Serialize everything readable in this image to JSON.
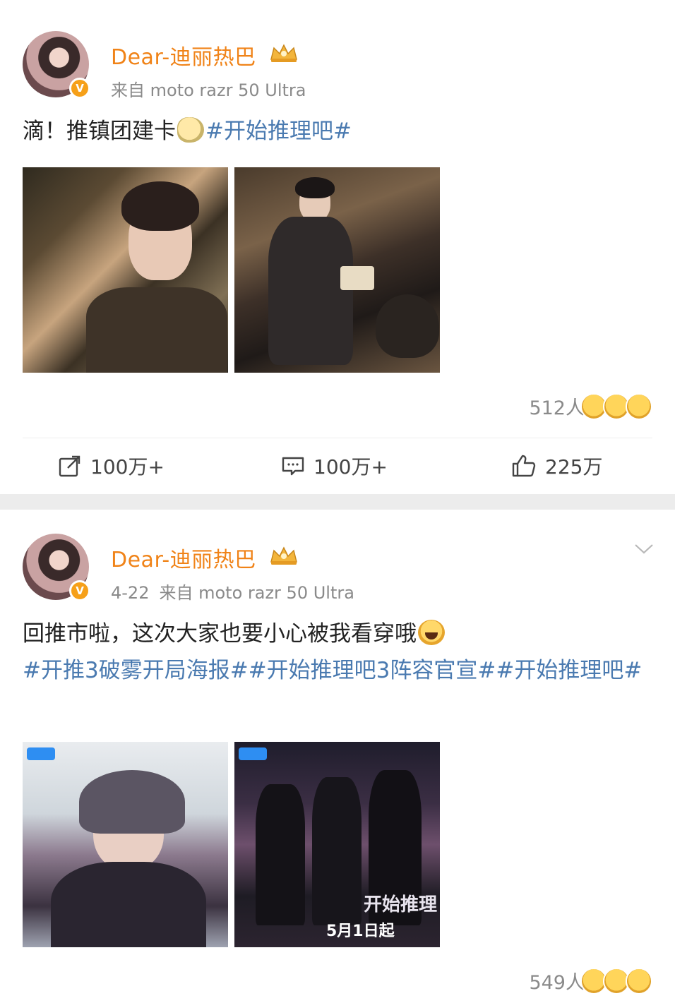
{
  "posts": [
    {
      "username": "Dear-迪丽热巴",
      "verified_badge": "V",
      "date": "",
      "source": "来自 moto razr 50 Ultra",
      "text_plain": "滴！推镇团建卡",
      "hashtags_line": "#开始推理吧#",
      "reactions_count": "512人",
      "actions": {
        "repost": "100万+",
        "comment": "100万+",
        "like": "225万"
      }
    },
    {
      "username": "Dear-迪丽热巴",
      "verified_badge": "V",
      "date": "4-22",
      "source": "来自 moto razr 50 Ultra",
      "text_plain": "回推市啦，这次大家也要小心被我看穿哦",
      "hashtags_line": "#开推3破雾开局海报##开始推理吧3阵容官宣##开始推理吧#",
      "reactions_count": "549人",
      "poster_text": "5月1日起",
      "poster_title": "开始推理"
    }
  ],
  "colors": {
    "username": "#f08318",
    "hashtag": "#4a7ab0",
    "meta": "#8a8a8a",
    "badge": "#f6a019",
    "divider": "#ececec"
  }
}
